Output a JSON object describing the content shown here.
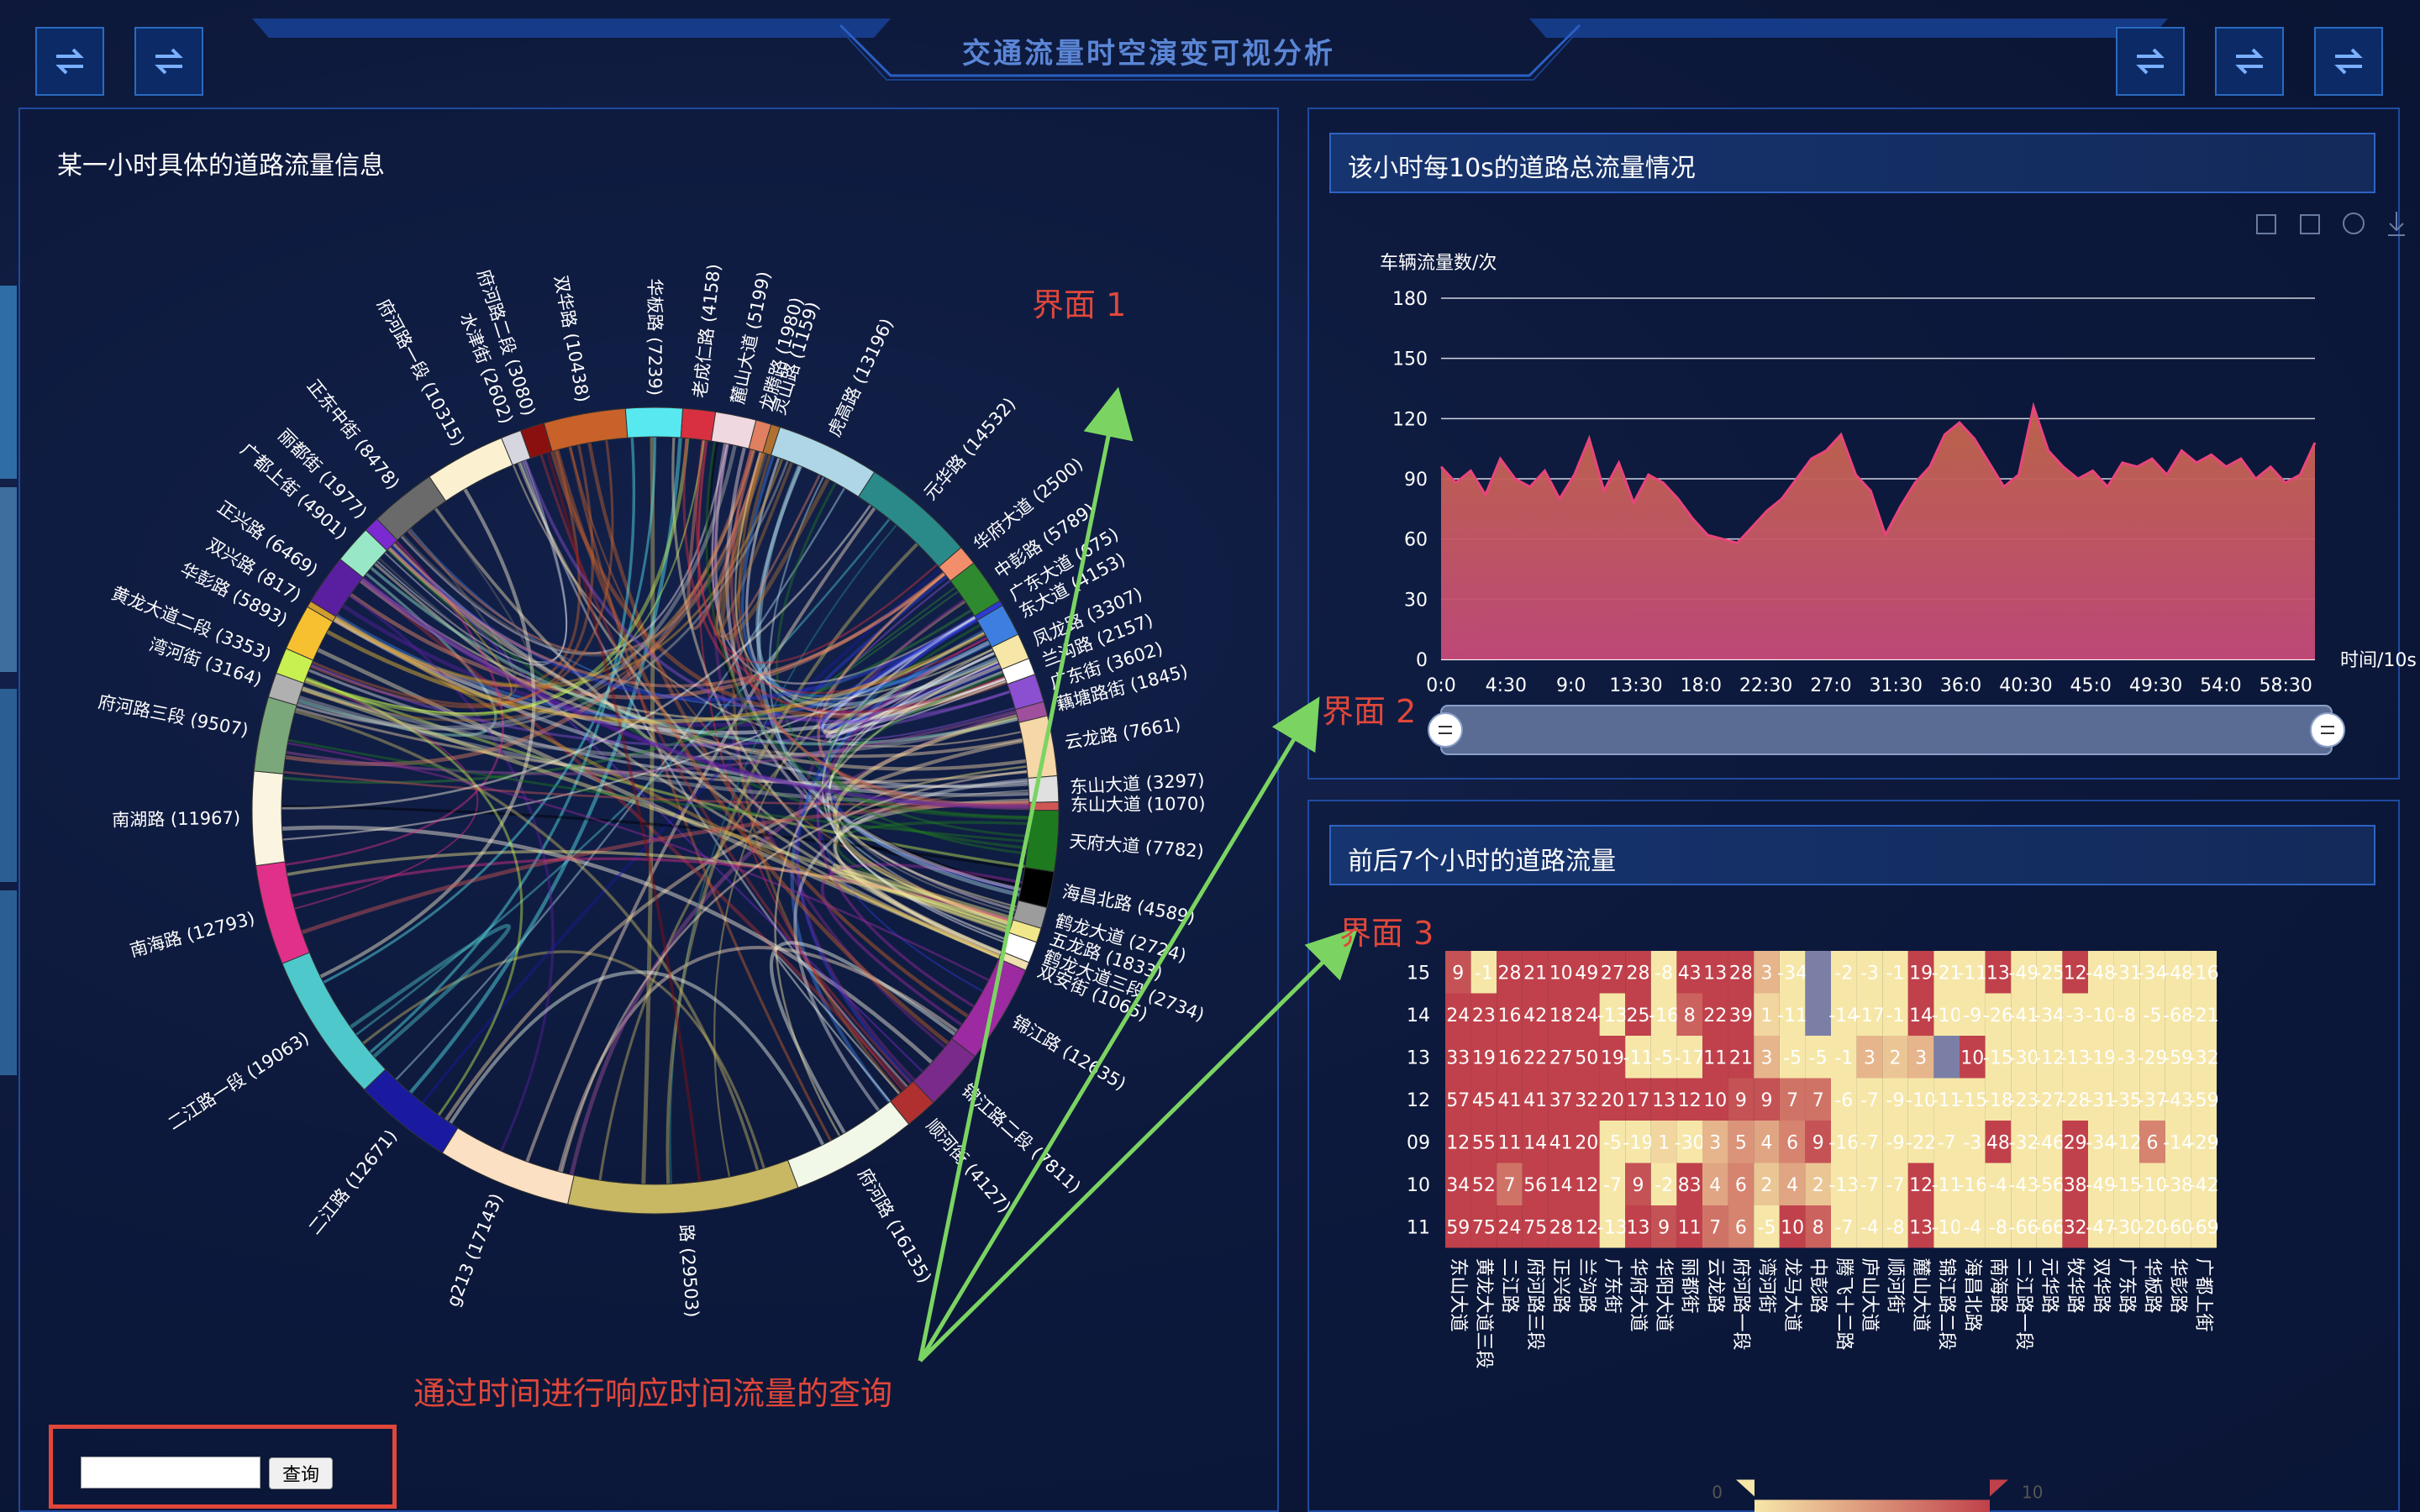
{
  "header": {
    "title": "交通流量时空演变可视分析"
  },
  "colors": {
    "accent": "#5b86d6",
    "red": "#e0473a",
    "green": "#7bd462",
    "area_line": "#e8457a"
  },
  "left_panel": {
    "title": "某一小时具体的道路流量信息",
    "query_button": "查询",
    "query_value": ""
  },
  "annotations": {
    "view1": "界面 1",
    "view2": "界面 2",
    "view3": "界面 3",
    "query_note": "通过时间进行响应时间流量的查询"
  },
  "chord": {
    "labels": [
      "虎高路 (13196)",
      "元华路 (14532)",
      "华府大道 (2500)",
      "中彭路 (5789)",
      "广东大道 (675)",
      "东大道 (4153)",
      "凤龙路 (3307)",
      "兰沟路 (2157)",
      "广东街 (3602)",
      "藕塘路街 (1845)",
      "云龙路 (7661)",
      "东山大道 (3297)",
      "东山大道 (1070)",
      "天府大道 (7782)",
      "海昌北路 (4589)",
      "鹤龙大道 (2724)",
      "五龙路 (1833)",
      "鹤龙大道三段 (2734)",
      "双安街 (1065)",
      "锦江路 (12635)",
      "锦江路二段 (7811)",
      "顺河街 (4127)",
      "府河路 (16135)",
      "路 (29503)",
      "g213 (17143)",
      "二江路 (12671)",
      "二江路一段 (19063)",
      "南海路 (12793)",
      "南湖路 (11967)",
      "府河路三段 (9507)",
      "湾河街 (3164)",
      "黄龙大道二段 (3353)",
      "华彭路 (5893)",
      "双兴路 (817)",
      "正兴路 (6469)",
      "广都上街 (4901)",
      "丽都街 (1977)",
      "正东中街 (8478)",
      "府河路一段 (10315)",
      "水津街 (2602)",
      "府河路二段 (3080)",
      "双华路 (10438)",
      "华板路 (7239)",
      "老成仁路 (4158)",
      "麓山大道 (5199)",
      "龙腾路 (1980)",
      "灵山路 (1159)"
    ]
  },
  "line_chart": {
    "title": "该小时每10s的道路总流量情况",
    "toolbar_icons": [
      "zoom-icon",
      "zoom-back-icon",
      "restore-icon",
      "download-icon"
    ]
  },
  "chart_data": [
    {
      "type": "area",
      "title": "",
      "ylabel": "车辆流量数/次",
      "xlabel": "时间/10s",
      "ylim": [
        0,
        180
      ],
      "yticks": [
        "0",
        "30",
        "60",
        "90",
        "120",
        "150",
        "180"
      ],
      "xticks": [
        "0:0",
        "4:30",
        "9:0",
        "13:30",
        "18:0",
        "22:30",
        "27:0",
        "31:30",
        "36:0",
        "40:30",
        "45:0",
        "49:30",
        "54:0",
        "58:30"
      ],
      "x": [
        0,
        1,
        2,
        3,
        4,
        5,
        6,
        7,
        8,
        9,
        10,
        11,
        12,
        13,
        14,
        15,
        16,
        17,
        18,
        19,
        20,
        21,
        22,
        23,
        24,
        25,
        26,
        27,
        28,
        29,
        30,
        31,
        32,
        33,
        34,
        35,
        36,
        37,
        38,
        39,
        40,
        41,
        42,
        43,
        44,
        45,
        46,
        47,
        48,
        49,
        50,
        51,
        52,
        53,
        54,
        55,
        56,
        57,
        58,
        59
      ],
      "values": [
        96,
        88,
        94,
        82,
        100,
        90,
        86,
        94,
        80,
        92,
        110,
        84,
        98,
        78,
        92,
        88,
        80,
        70,
        62,
        60,
        58,
        66,
        74,
        80,
        90,
        100,
        104,
        112,
        92,
        84,
        62,
        76,
        88,
        96,
        112,
        118,
        110,
        98,
        86,
        92,
        126,
        104,
        96,
        90,
        94,
        86,
        98,
        96,
        100,
        92,
        104,
        98,
        102,
        96,
        100,
        90,
        96,
        88,
        92,
        108
      ]
    },
    {
      "type": "heatmap",
      "title": "前后7个小时的道路流量",
      "y": [
        "15",
        "14",
        "13",
        "12",
        "09",
        "10",
        "11"
      ],
      "x": [
        "东山大道",
        "黄龙大道三段",
        "二江路",
        "府河路三段",
        "正兴路",
        "兰沟路",
        "广东街",
        "华府大道",
        "华阳大道",
        "丽都街",
        "云龙路",
        "府河路一段",
        "湾河街",
        "龙马大道",
        "中彭路",
        "腾飞十二路",
        "庐山大道",
        "顺河街",
        "麓山大道",
        "锦江路二段",
        "海昌北路",
        "南海路",
        "二江路一段",
        "元华路",
        "牧华路",
        "双华路",
        "广东路",
        "华板路",
        "华彭路",
        "广都上街"
      ],
      "values": [
        [
          "9",
          "-1",
          "28",
          "21",
          "10",
          "49",
          "27",
          "28",
          "-8",
          "43",
          "13",
          "28",
          "3",
          "-34",
          "",
          "-2",
          "-3",
          "-1",
          "19",
          "-21",
          "-11",
          "13",
          "-49",
          "-25",
          "12",
          "-48",
          "-31",
          "-34",
          "-48",
          "-16"
        ],
        [
          "24",
          "23",
          "16",
          "42",
          "18",
          "24",
          "-13",
          "25",
          "-16",
          "8",
          "22",
          "39",
          "1",
          "-11",
          "",
          "-14",
          "-17",
          "-1",
          "14",
          "-10",
          "-9",
          "-26",
          "-41",
          "-34",
          "-3",
          "-10",
          "-8",
          "-5",
          "-68",
          "-21"
        ],
        [
          "33",
          "19",
          "16",
          "22",
          "27",
          "50",
          "19",
          "-11",
          "-5",
          "-17",
          "11",
          "21",
          "3",
          "-5",
          "-5",
          "-1",
          "3",
          "2",
          "3",
          "",
          "10",
          "-15",
          "-30",
          "-12",
          "-13",
          "-19",
          "-3",
          "-29",
          "-59",
          "-32"
        ],
        [
          "57",
          "45",
          "41",
          "41",
          "37",
          "32",
          "20",
          "17",
          "13",
          "12",
          "10",
          "9",
          "9",
          "7",
          "7",
          "-6",
          "-7",
          "-9",
          "-10",
          "-11",
          "-15",
          "-18",
          "-23",
          "-27",
          "-28",
          "-31",
          "-35",
          "-37",
          "-43",
          "-59"
        ],
        [
          "12",
          "55",
          "11",
          "14",
          "41",
          "20",
          "-5",
          "-19",
          "1",
          "-30",
          "3",
          "5",
          "4",
          "6",
          "9",
          "-16",
          "-7",
          "-9",
          "-22",
          "-7",
          "-3",
          "48",
          "-32",
          "-46",
          "29",
          "-34",
          "-12",
          "6",
          "-14",
          "-29"
        ],
        [
          "34",
          "52",
          "7",
          "56",
          "14",
          "12",
          "-7",
          "9",
          "-2",
          "83",
          "4",
          "6",
          "2",
          "4",
          "2",
          "-13",
          "-7",
          "-7",
          "12",
          "-11",
          "-16",
          "-4",
          "-43",
          "-56",
          "38",
          "-49",
          "-15",
          "-10",
          "-38",
          "-42"
        ],
        [
          "59",
          "75",
          "24",
          "75",
          "28",
          "12",
          "-13",
          "13",
          "9",
          "11",
          "7",
          "6",
          "-5",
          "10",
          "8",
          "-7",
          "-4",
          "-8",
          "13",
          "-10",
          "-4",
          "-8",
          "-66",
          "-66",
          "32",
          "-47",
          "-30",
          "-20",
          "-60",
          "-69"
        ]
      ],
      "color_scale": {
        "min": "0",
        "max": "10",
        "low": "#f6e7a8",
        "high": "#c0414b"
      }
    }
  ]
}
